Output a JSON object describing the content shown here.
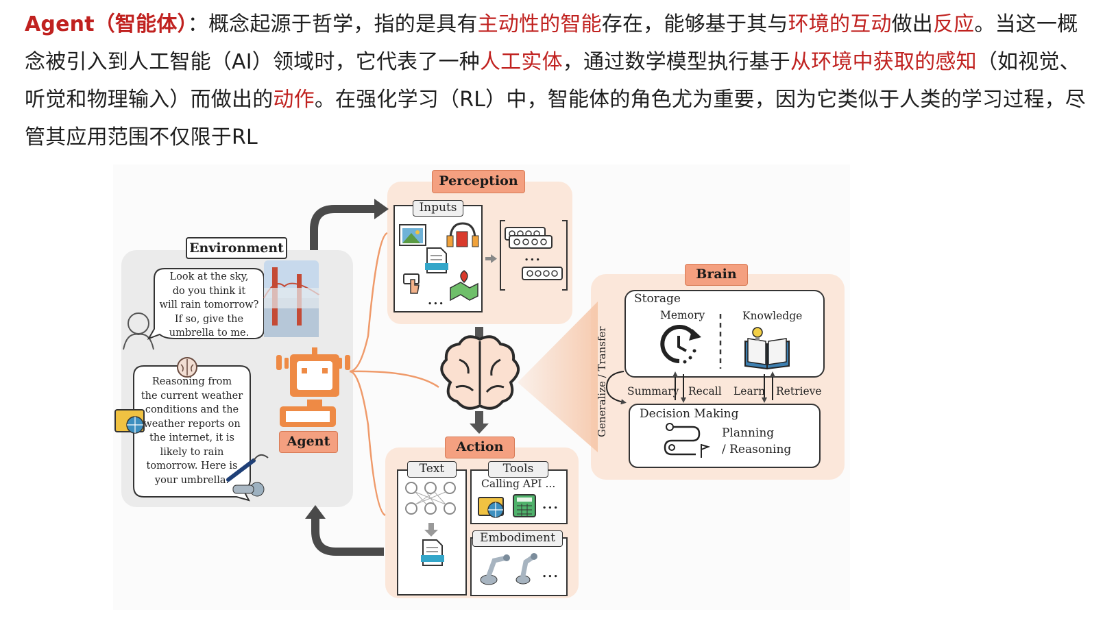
{
  "intro": {
    "segments": [
      {
        "text": "Agent（智能体）",
        "style": "title"
      },
      {
        "text": "：概念起源于哲学，指的是具有",
        "style": "plain"
      },
      {
        "text": "主动性的智能",
        "style": "hl"
      },
      {
        "text": "存在，能够基于其与",
        "style": "plain"
      },
      {
        "text": "环境的互动",
        "style": "hl"
      },
      {
        "text": "做出",
        "style": "plain"
      },
      {
        "text": "反应",
        "style": "hl"
      },
      {
        "text": "。当这一概念被引入到人工智能（AI）领域时，它代表了一种",
        "style": "plain"
      },
      {
        "text": "人工实体",
        "style": "hl"
      },
      {
        "text": "，通过数学模型执行基于",
        "style": "plain"
      },
      {
        "text": "从环境中获取的感知",
        "style": "hl"
      },
      {
        "text": "（如视觉、听觉和物理输入）而做出的",
        "style": "plain"
      },
      {
        "text": "动作",
        "style": "hl"
      },
      {
        "text": "。在强化学习（RL）中，智能体的角色尤为重要，因为它类似于人类的学习过程，尽管其应用范围不仅限于RL",
        "style": "plain"
      }
    ]
  },
  "colors": {
    "highlight": "#c0211f",
    "pill": "#f4a080",
    "panel": "#fbe7da",
    "env_panel": "#ebebeb",
    "agent_orange": "#ee8a45"
  },
  "diagram": {
    "environment": {
      "label": "Environment",
      "speech": [
        "Look at the sky,",
        "do you think it",
        "will rain tomorrow?",
        "If so, give the",
        "umbrella to me."
      ],
      "reply": [
        "Reasoning from",
        "the current weather",
        "conditions and the",
        "weather reports on",
        "the internet, it is",
        "likely to rain",
        "tomorrow. Here is",
        "your umbrella."
      ]
    },
    "agent": {
      "label": "Agent"
    },
    "perception": {
      "label": "Perception",
      "inputs_label": "Inputs",
      "ellipsis": "..."
    },
    "action": {
      "label": "Action",
      "text_label": "Text",
      "tools_label": "Tools",
      "calling_api": "Calling API ...",
      "embodiment_label": "Embodiment",
      "ellipsis": "..."
    },
    "brain": {
      "label": "Brain",
      "storage_label": "Storage",
      "memory_label": "Memory",
      "knowledge_label": "Knowledge",
      "summary_label": "Summary",
      "recall_label": "Recall",
      "learn_label": "Learn",
      "retrieve_label": "Retrieve",
      "decision_label": "Decision Making",
      "planning_label": "Planning",
      "reasoning_label": "/ Reasoning",
      "side_label": "Generalize / Transfer"
    },
    "icons": [
      "person-icon",
      "brain-icon",
      "robot-icon",
      "image-icon",
      "headphones-icon",
      "txt-file-icon",
      "pointer-icon",
      "map-pin-icon",
      "memory-cycle-icon",
      "book-bulb-icon",
      "route-flag-icon",
      "network-icon",
      "calculator-icon",
      "browser-globe-icon",
      "robot-arm-icon",
      "umbrella-icon",
      "cursor-icon"
    ]
  }
}
